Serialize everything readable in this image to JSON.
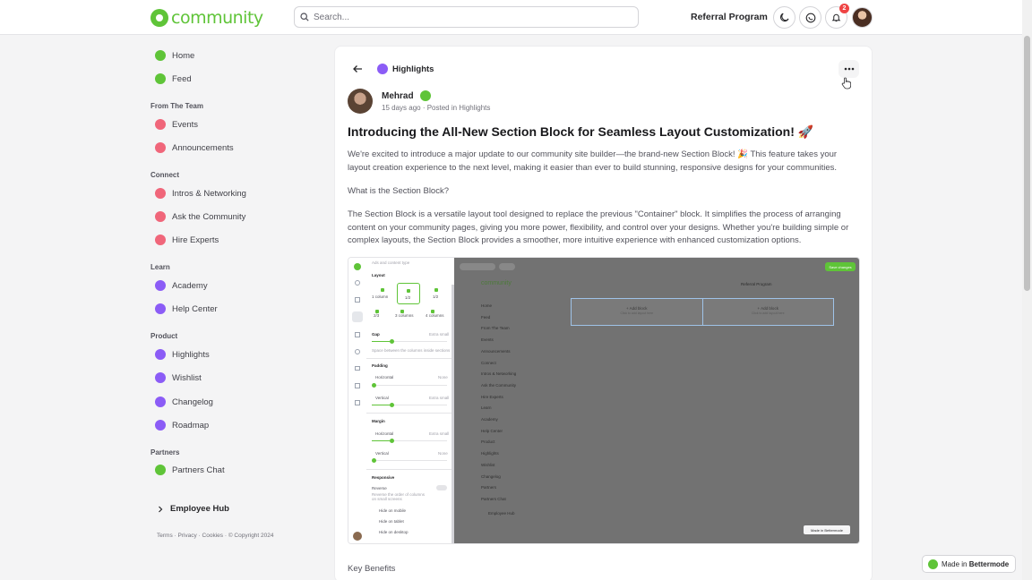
{
  "header": {
    "logo_text": "community",
    "search_placeholder": "Search...",
    "referral": "Referral Program",
    "notification_count": "2"
  },
  "sidebar": {
    "items": [
      {
        "label": "Home",
        "color": "#5fc438"
      },
      {
        "label": "Feed",
        "color": "#5fc438"
      }
    ],
    "sections": [
      {
        "title": "From The Team",
        "items": [
          {
            "label": "Events",
            "color": "#f0667a"
          },
          {
            "label": "Announcements",
            "color": "#f0667a"
          }
        ]
      },
      {
        "title": "Connect",
        "items": [
          {
            "label": "Intros & Networking",
            "color": "#f0667a"
          },
          {
            "label": "Ask the Community",
            "color": "#f0667a"
          },
          {
            "label": "Hire Experts",
            "color": "#f0667a"
          }
        ]
      },
      {
        "title": "Learn",
        "items": [
          {
            "label": "Academy",
            "color": "#8b5cf6"
          },
          {
            "label": "Help Center",
            "color": "#8b5cf6"
          }
        ]
      },
      {
        "title": "Product",
        "items": [
          {
            "label": "Highlights",
            "color": "#8b5cf6"
          },
          {
            "label": "Wishlist",
            "color": "#8b5cf6"
          },
          {
            "label": "Changelog",
            "color": "#8b5cf6"
          },
          {
            "label": "Roadmap",
            "color": "#8b5cf6"
          }
        ]
      },
      {
        "title": "Partners",
        "items": [
          {
            "label": "Partners Chat",
            "color": "#5fc438"
          }
        ]
      }
    ],
    "employee_hub": "Employee Hub",
    "footer": "Terms · Privacy · Cookies · © Copyright 2024"
  },
  "post": {
    "space": "Highlights",
    "author": "Mehrad",
    "meta": "15 days ago · Posted in Highlights",
    "title": "Introducing the All-New Section Block for Seamless Layout Customization! 🚀",
    "p1": "We're excited to introduce a major update to our community site builder—the brand-new Section Block! 🎉 This feature takes your layout creation experience to the next level, making it easier than ever to build stunning, responsive designs for your communities.",
    "p2": "What is the Section Block?",
    "p3": "The Section Block is a versatile layout tool designed to replace the previous \"Container\" block. It simplifies the process of arranging content on your community pages, giving you more power, flexibility, and control over your designs. Whether you're building simple or complex layouts, the Section Block provides a smoother, more intuitive experience with enhanced customization options.",
    "key_benefits": "Key Benefits"
  },
  "embedded": {
    "panel_top": "Ads and content type",
    "layout": "Layout",
    "layout_opts": [
      "1 column",
      "1/2",
      "1/2",
      "2/3",
      "3 columns",
      "4 columns"
    ],
    "gap": "Gap",
    "gap_val": "Extra small",
    "gap_desc": "Space between the columns inside sections",
    "padding": "Padding",
    "horizontal": "Horizontal",
    "vertical": "Vertical",
    "none": "None",
    "extra_small": "Extra small",
    "margin": "Margin",
    "responsive": "Responsive",
    "reverse": "Reverse",
    "reverse_desc": "Reverse the order of columns on small screens",
    "hide_mobile": "Hide on mobile",
    "hide_tablet": "Hide on tablet",
    "hide_desktop": "Hide on desktop",
    "save": "Save changes",
    "ref": "Referral Program",
    "add_block": "+ Add block",
    "add_block_sub": "Click to add layout here",
    "made_in": "Made in Bettermode",
    "nav": [
      "Home",
      "Feed",
      "From The Team",
      "Events",
      "Announcements",
      "Connect",
      "Intros & Networking",
      "Ask the Community",
      "Hire Experts",
      "Learn",
      "Academy",
      "Help Center",
      "Product",
      "Highlights",
      "Wishlist",
      "Changelog",
      "Partners",
      "Partners Chat"
    ],
    "employee_hub": "Employee Hub"
  },
  "badge": {
    "made_in": "Made in",
    "brand": "Bettermode"
  }
}
